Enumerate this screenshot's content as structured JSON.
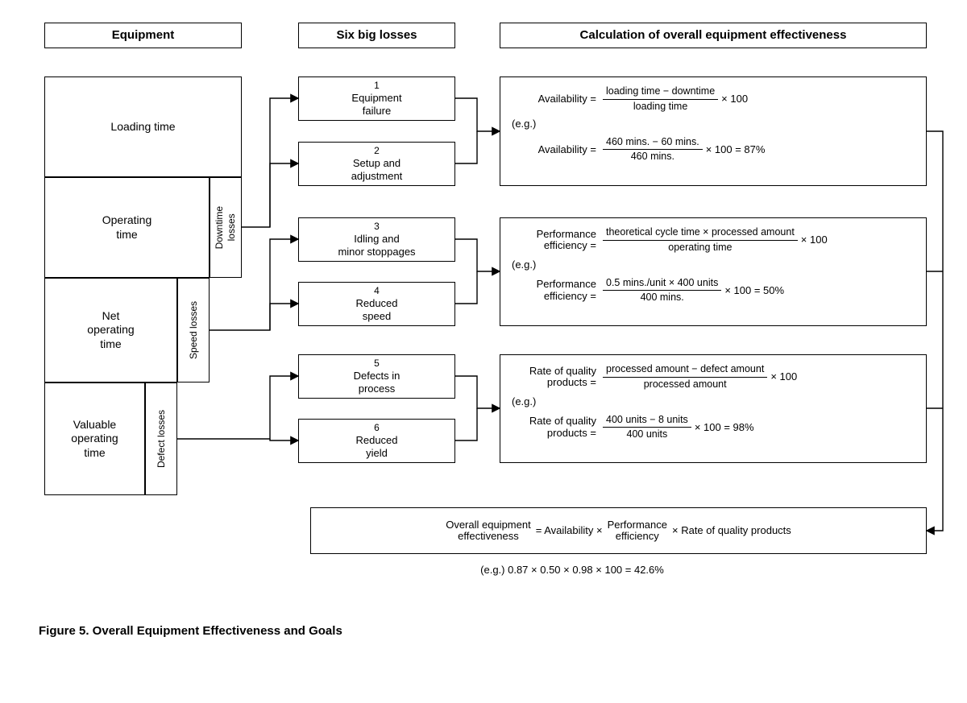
{
  "headers": {
    "equipment": "Equipment",
    "losses": "Six big losses",
    "calc": "Calculation of overall equipment effectiveness"
  },
  "equipment_blocks": {
    "loading": "Loading time",
    "operating": "Operating\ntime",
    "net_operating": "Net\noperating\ntime",
    "valuable": "Valuable\noperating\ntime"
  },
  "loss_side_labels": {
    "downtime": "Downtime\nlosses",
    "speed": "Speed losses",
    "defect": "Defect losses"
  },
  "losses": [
    {
      "num": "1",
      "label": "Equipment\nfailure"
    },
    {
      "num": "2",
      "label": "Setup and\nadjustment"
    },
    {
      "num": "3",
      "label": "Idling and\nminor stoppages"
    },
    {
      "num": "4",
      "label": "Reduced\nspeed"
    },
    {
      "num": "5",
      "label": "Defects in\nprocess"
    },
    {
      "num": "6",
      "label": "Reduced\nyield"
    }
  ],
  "calc1": {
    "lhs": "Availability =",
    "f1top": "loading time − downtime",
    "f1bot": "loading time",
    "tail1": "× 100",
    "eg": "(e.g.)",
    "lhs2": "Availability =",
    "f2top": "460 mins. − 60 mins.",
    "f2bot": "460 mins.",
    "tail2": "× 100 = 87%"
  },
  "calc2": {
    "lhs": "Performance\nefficiency =",
    "f1top": "theoretical cycle time × processed amount",
    "f1bot": "operating time",
    "tail1": "× 100",
    "eg": "(e.g.)",
    "lhs2": "Performance\nefficiency =",
    "f2top": "0.5 mins./unit × 400 units",
    "f2bot": "400 mins.",
    "tail2": "× 100 = 50%"
  },
  "calc3": {
    "lhs": "Rate of quality\nproducts =",
    "f1top": "processed amount − defect amount",
    "f1bot": "processed amount",
    "tail1": "× 100",
    "eg": "(e.g.)",
    "lhs2": "Rate of quality\nproducts =",
    "f2top": "400 units − 8 units",
    "f2bot": "400 units",
    "tail2": "× 100 = 98%"
  },
  "oee": {
    "lhs": "Overall equipment\neffectiveness",
    "eq": "=  Availability  ×",
    "mid": "Performance\nefficiency",
    "tail": "×  Rate of quality products"
  },
  "eg_final": "(e.g.)   0.87 × 0.50 × 0.98 × 100 = 42.6%",
  "caption": "Figure 5.  Overall Equipment Effectiveness and Goals"
}
